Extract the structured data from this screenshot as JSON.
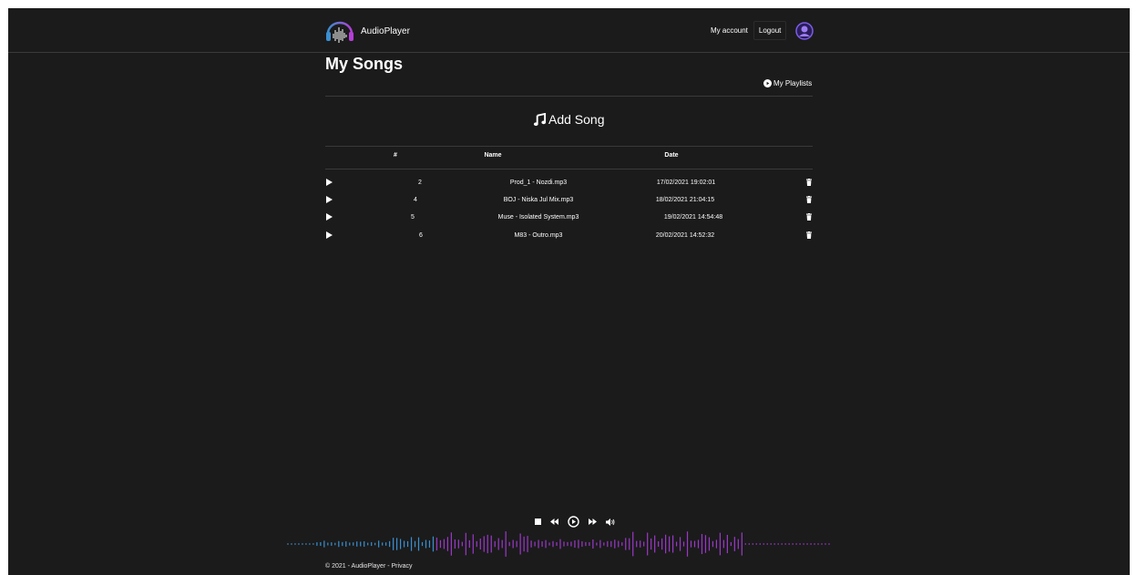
{
  "app": {
    "name": "AudioPlayer"
  },
  "nav": {
    "my_account": "My account",
    "logout": "Logout"
  },
  "page": {
    "title": "My Songs",
    "playlists_link": "My Playlists",
    "add_song": "Add Song"
  },
  "table": {
    "headers": [
      "#",
      "Name",
      "Date"
    ],
    "rows": [
      {
        "num": "2",
        "name": "Prod_1 - Nozdi.mp3",
        "date": "17/02/2021 19:02:01"
      },
      {
        "num": "4",
        "name": "BOJ - Niska Jul Mix.mp3",
        "date": "18/02/2021 21:04:15"
      },
      {
        "num": "5",
        "name": "Muse - Isolated System.mp3",
        "date": "19/02/2021 14:54:48"
      },
      {
        "num": "6",
        "name": "M83 - Outro.mp3",
        "date": "20/02/2021 14:52:32"
      }
    ]
  },
  "player": {
    "controls": [
      "stop-icon",
      "rewind-icon",
      "play-circle-icon",
      "fast-forward-icon",
      "volume-icon"
    ]
  },
  "footer": {
    "copyright": "© 2021",
    "app": "AudioPlayer",
    "privacy": "Privacy"
  },
  "colors": {
    "background": "#1b1b1b",
    "wave_blue": "#3a8fd0",
    "wave_purple": "#9b38c9",
    "accent": "#6a4fd8"
  }
}
